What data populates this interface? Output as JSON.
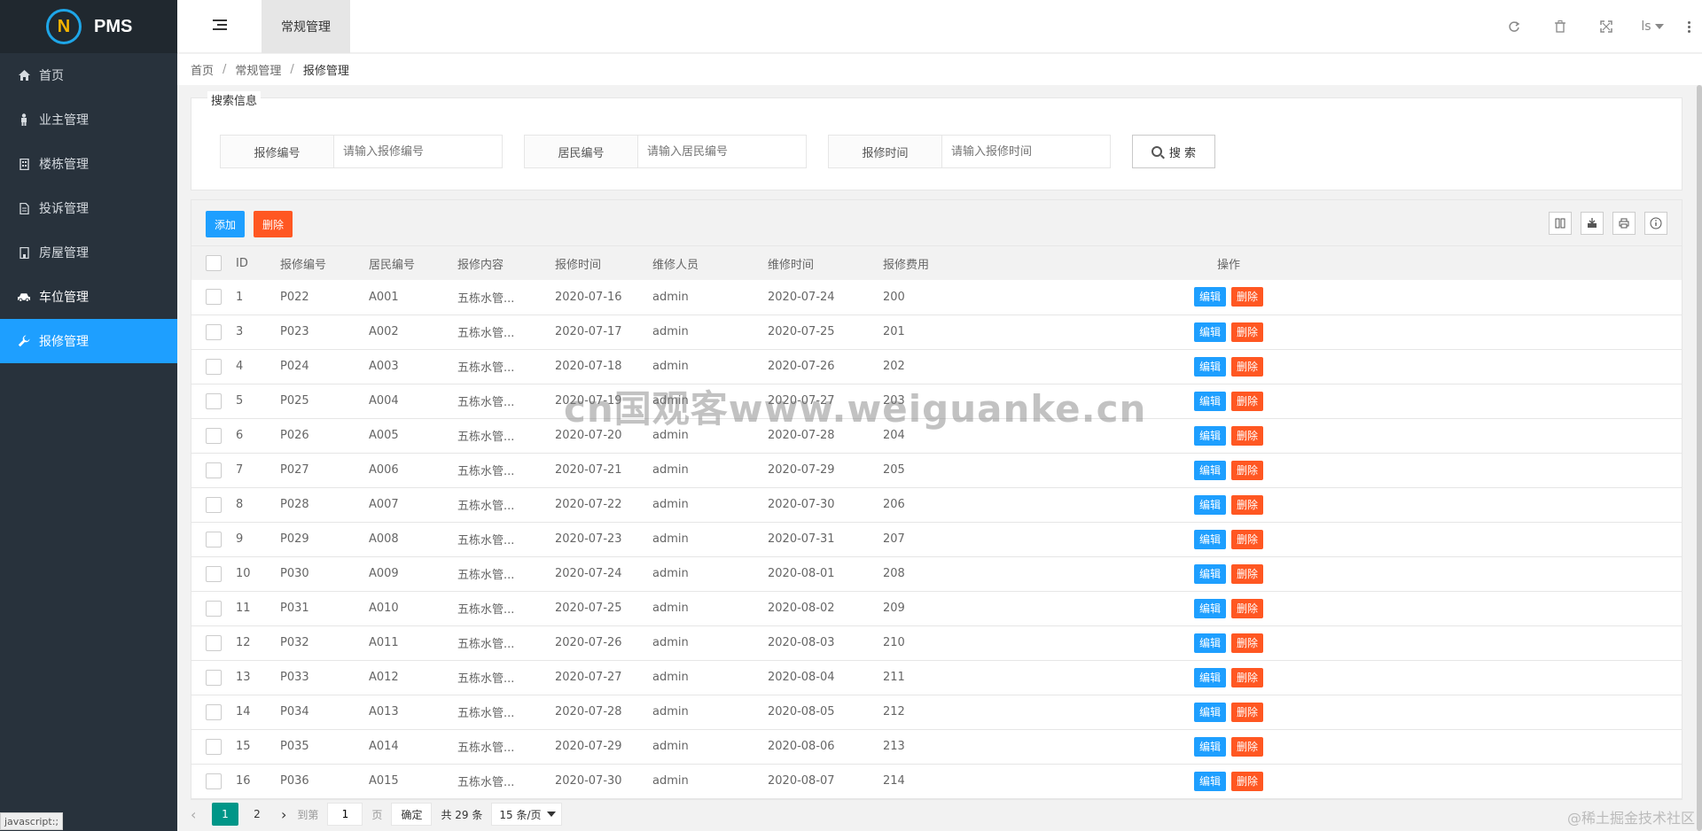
{
  "app": {
    "logo_letter": "N",
    "name": "PMS"
  },
  "sidebar": {
    "items": [
      {
        "label": "首页",
        "icon": "home-icon"
      },
      {
        "label": "业主管理",
        "icon": "person-icon"
      },
      {
        "label": "楼栋管理",
        "icon": "building-icon"
      },
      {
        "label": "投诉管理",
        "icon": "document-icon"
      },
      {
        "label": "房屋管理",
        "icon": "house-icon"
      },
      {
        "label": "车位管理",
        "icon": "car-icon"
      },
      {
        "label": "报修管理",
        "icon": "wrench-icon"
      }
    ]
  },
  "header": {
    "tab": "常规管理",
    "user": "ls"
  },
  "breadcrumb": {
    "home": "首页",
    "section": "常规管理",
    "current": "报修管理"
  },
  "search": {
    "legend": "搜索信息",
    "fields": [
      {
        "label": "报修编号",
        "placeholder": "请输入报修编号"
      },
      {
        "label": "居民编号",
        "placeholder": "请输入居民编号"
      },
      {
        "label": "报修时间",
        "placeholder": "请输入报修时间"
      }
    ],
    "button": "搜 索"
  },
  "toolbar": {
    "add": "添加",
    "delete": "删除"
  },
  "table": {
    "columns": [
      "ID",
      "报修编号",
      "居民编号",
      "报修内容",
      "报修时间",
      "维修人员",
      "维修时间",
      "报修费用",
      "操作"
    ],
    "edit_label": "编辑",
    "delete_label": "删除",
    "rows": [
      [
        "1",
        "P022",
        "A001",
        "五栋水管...",
        "2020-07-16",
        "admin",
        "2020-07-24",
        "200"
      ],
      [
        "3",
        "P023",
        "A002",
        "五栋水管...",
        "2020-07-17",
        "admin",
        "2020-07-25",
        "201"
      ],
      [
        "4",
        "P024",
        "A003",
        "五栋水管...",
        "2020-07-18",
        "admin",
        "2020-07-26",
        "202"
      ],
      [
        "5",
        "P025",
        "A004",
        "五栋水管...",
        "2020-07-19",
        "admin",
        "2020-07-27",
        "203"
      ],
      [
        "6",
        "P026",
        "A005",
        "五栋水管...",
        "2020-07-20",
        "admin",
        "2020-07-28",
        "204"
      ],
      [
        "7",
        "P027",
        "A006",
        "五栋水管...",
        "2020-07-21",
        "admin",
        "2020-07-29",
        "205"
      ],
      [
        "8",
        "P028",
        "A007",
        "五栋水管...",
        "2020-07-22",
        "admin",
        "2020-07-30",
        "206"
      ],
      [
        "9",
        "P029",
        "A008",
        "五栋水管...",
        "2020-07-23",
        "admin",
        "2020-07-31",
        "207"
      ],
      [
        "10",
        "P030",
        "A009",
        "五栋水管...",
        "2020-07-24",
        "admin",
        "2020-08-01",
        "208"
      ],
      [
        "11",
        "P031",
        "A010",
        "五栋水管...",
        "2020-07-25",
        "admin",
        "2020-08-02",
        "209"
      ],
      [
        "12",
        "P032",
        "A011",
        "五栋水管...",
        "2020-07-26",
        "admin",
        "2020-08-03",
        "210"
      ],
      [
        "13",
        "P033",
        "A012",
        "五栋水管...",
        "2020-07-27",
        "admin",
        "2020-08-04",
        "211"
      ],
      [
        "14",
        "P034",
        "A013",
        "五栋水管...",
        "2020-07-28",
        "admin",
        "2020-08-05",
        "212"
      ],
      [
        "15",
        "P035",
        "A014",
        "五栋水管...",
        "2020-07-29",
        "admin",
        "2020-08-06",
        "213"
      ],
      [
        "16",
        "P036",
        "A015",
        "五栋水管...",
        "2020-07-30",
        "admin",
        "2020-08-07",
        "214"
      ]
    ]
  },
  "pager": {
    "pages": [
      "1",
      "2"
    ],
    "goto_label": "到第",
    "page_value": "1",
    "page_unit": "页",
    "confirm": "确定",
    "total": "共 29 条",
    "per_page": "15 条/页"
  },
  "status_bar": "javascript:;",
  "watermark": "cn国观客www.weiguanke.cn",
  "corner_mark": "@稀土掘金技术社区",
  "colors": {
    "primary": "#1e9fff",
    "danger": "#ff5722",
    "sidebar": "#28323c",
    "pager_active": "#009688"
  }
}
